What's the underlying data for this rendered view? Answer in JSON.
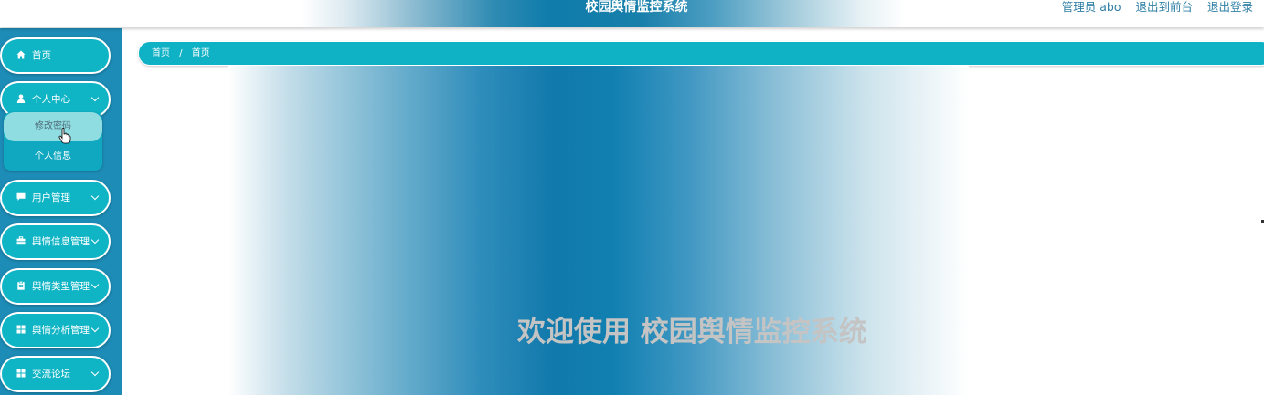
{
  "header": {
    "title": "校园舆情监控系统",
    "user_label": "管理员 abo",
    "front_link": "退出到前台",
    "logout_link": "退出登录"
  },
  "sidebar": {
    "items": [
      {
        "label": "首页",
        "icon": "home-icon",
        "expandable": false
      },
      {
        "label": "个人中心",
        "icon": "user-icon",
        "expandable": true,
        "expanded": true,
        "children": [
          {
            "label": "修改密码",
            "active": true
          },
          {
            "label": "个人信息",
            "active": false
          }
        ]
      },
      {
        "label": "用户管理",
        "icon": "chat-icon",
        "expandable": true
      },
      {
        "label": "舆情信息管理",
        "icon": "briefcase-icon",
        "expandable": true
      },
      {
        "label": "舆情类型管理",
        "icon": "clipboard-icon",
        "expandable": true
      },
      {
        "label": "舆情分析管理",
        "icon": "grid-icon",
        "expandable": true
      },
      {
        "label": "交流论坛",
        "icon": "grid-icon",
        "expandable": true
      }
    ]
  },
  "breadcrumb": {
    "items": [
      "首页",
      "首页"
    ],
    "separator": "/"
  },
  "main": {
    "welcome_text": "欢迎使用 校园舆情监控系统"
  },
  "colors": {
    "sidebar_bg": "#1d8cb6",
    "menu_item_bg": "#10b5c5",
    "breadcrumb_bg": "#0fb1c4",
    "active_submenu_bg": "#8fdde0",
    "header_link": "#2f7fa5",
    "welcome_text": "#c4c4c4"
  }
}
